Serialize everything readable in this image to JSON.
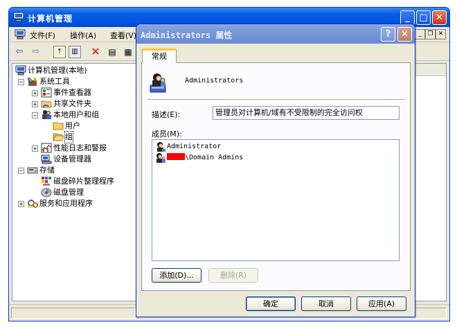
{
  "main_window": {
    "title": "计算机管理",
    "menu": [
      "文件(F)",
      "操作(A)",
      "查看(V)"
    ],
    "tree": [
      {
        "label": "计算机管理(本地)",
        "level": 0,
        "expander": "",
        "icon": "computer-icon"
      },
      {
        "label": "系统工具",
        "level": 1,
        "expander": "−",
        "icon": "tools-icon"
      },
      {
        "label": "事件查看器",
        "level": 2,
        "expander": "+",
        "icon": "event-viewer-icon"
      },
      {
        "label": "共享文件夹",
        "level": 2,
        "expander": "+",
        "icon": "shared-folder-icon"
      },
      {
        "label": "本地用户和组",
        "level": 2,
        "expander": "−",
        "icon": "users-groups-icon"
      },
      {
        "label": "用户",
        "level": 3,
        "expander": "",
        "icon": "folder-icon"
      },
      {
        "label": "组",
        "level": 3,
        "expander": "",
        "icon": "folder-open-icon",
        "selected": true
      },
      {
        "label": "性能日志和警报",
        "level": 2,
        "expander": "+",
        "icon": "performance-icon"
      },
      {
        "label": "设备管理器",
        "level": 2,
        "expander": "",
        "icon": "device-manager-icon"
      },
      {
        "label": "存储",
        "level": 1,
        "expander": "−",
        "icon": "storage-icon"
      },
      {
        "label": "磁盘碎片整理程序",
        "level": 2,
        "expander": "",
        "icon": "defrag-icon"
      },
      {
        "label": "磁盘管理",
        "level": 2,
        "expander": "",
        "icon": "disk-management-icon"
      },
      {
        "label": "服务和应用程序",
        "level": 1,
        "expander": "+",
        "icon": "services-icon"
      }
    ]
  },
  "dialog": {
    "title": "Administrators 属性",
    "tab_label": "常规",
    "group_name": "Administrators",
    "description_label": "描述(E):",
    "description_value": "管理员对计算机/域有不受限制的完全访问权",
    "members_label": "成员(M):",
    "members": [
      {
        "prefix": "",
        "name": "Administrator",
        "redacted": false
      },
      {
        "prefix": "",
        "name": "\\Domain Admins",
        "redacted": true
      }
    ],
    "add_button": "添加(D)...",
    "remove_button": "删除(R)",
    "ok_button": "确定",
    "cancel_button": "取消",
    "apply_button": "应用(A)"
  }
}
